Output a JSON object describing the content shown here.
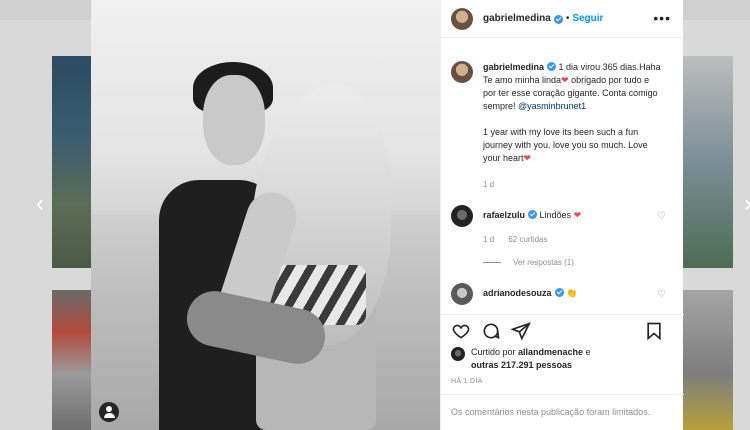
{
  "post": {
    "username": "gabrielmedina",
    "follow_label": "Seguir",
    "separator": "•",
    "more_label": "•••",
    "caption_text": "1 dia virou 365 dias.Haha Te amo minha linda",
    "caption_heart": "❤",
    "caption_text2": " obrigado por tudo e por ter esse coração gigante. Conta comigo sempre! ",
    "caption_mention": "@yasminbrunet1",
    "caption_en": "1 year with my love its been such a fun journey with you. love you so much. Love your heart",
    "caption_en_heart": "❤",
    "caption_age": "1 d"
  },
  "comments": [
    {
      "username": "rafaelzulu",
      "text": "Lindões ",
      "heart": "❤",
      "age": "1 d",
      "likes": "62 curtidas",
      "replies_label": "Ver respostas (1)"
    },
    {
      "username": "adrianodesouza",
      "text": "👏"
    }
  ],
  "likes_line": {
    "prefix": "Curtido por ",
    "user": "allandmenache",
    "suffix": " e",
    "others": "outras 217.291 pessoas"
  },
  "timestamp": "HÁ 1 DIA",
  "comments_limited": "Os comentários nesta publicação foram limitados.",
  "icons": [
    "heart-icon",
    "comment-icon",
    "share-icon",
    "bookmark-icon",
    "user-tag-icon",
    "chevron-left-icon",
    "chevron-right-icon"
  ],
  "colors": {
    "link": "#0095f6",
    "verified": "#3897f0",
    "heart": "#ed4956",
    "muted": "#8e8e8e"
  }
}
